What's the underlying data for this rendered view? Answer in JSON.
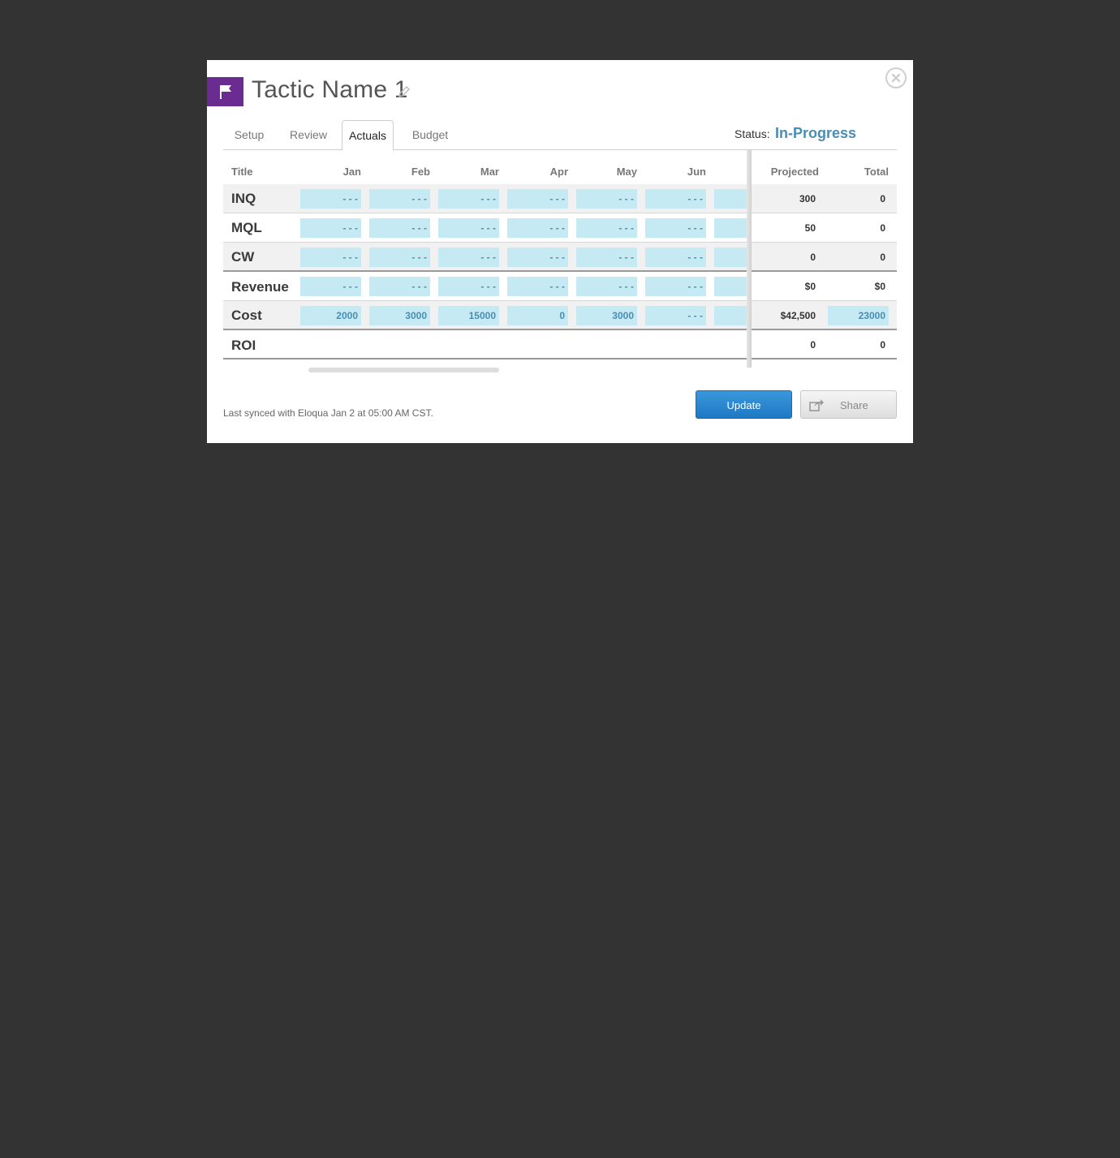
{
  "modal": {
    "title": "Tactic Name 1",
    "tabs": [
      "Setup",
      "Review",
      "Actuals",
      "Budget"
    ],
    "active_tab": "Actuals",
    "status_label": "Status:",
    "status_value": "In-Progress",
    "colors": {
      "accent": "#4a8db3",
      "flag": "#6b2c91",
      "update": "#2a87d0"
    }
  },
  "table": {
    "headers": {
      "title": "Title",
      "months": [
        "Jan",
        "Feb",
        "Mar",
        "Apr",
        "May",
        "Jun"
      ],
      "projected": "Projected",
      "total": "Total"
    },
    "rows": [
      {
        "title": "INQ",
        "cells": [
          "- - -",
          "- - -",
          "- - -",
          "- - -",
          "- - -",
          "- - -"
        ],
        "projected": "300",
        "total": "0"
      },
      {
        "title": "MQL",
        "cells": [
          "- - -",
          "- - -",
          "- - -",
          "- - -",
          "- - -",
          "- - -"
        ],
        "projected": "50",
        "total": "0"
      },
      {
        "title": "CW",
        "cells": [
          "- - -",
          "- - -",
          "- - -",
          "- - -",
          "- - -",
          "- - -"
        ],
        "projected": "0",
        "total": "0"
      },
      {
        "title": "Revenue",
        "cells": [
          "- - -",
          "- - -",
          "- - -",
          "- - -",
          "- - -",
          "- - -"
        ],
        "projected": "$0",
        "total": "$0"
      },
      {
        "title": "Cost",
        "cells": [
          "2000",
          "3000",
          "15000",
          "0",
          "3000",
          "- - -"
        ],
        "projected": "$42,500",
        "total": "23000"
      },
      {
        "title": "ROI",
        "cells": [],
        "projected": "0",
        "total": "0"
      }
    ]
  },
  "footer": {
    "sync_text": "Last synced with Eloqua Jan 2 at 05:00 AM CST.",
    "update_label": "Update",
    "share_label": "Share"
  }
}
